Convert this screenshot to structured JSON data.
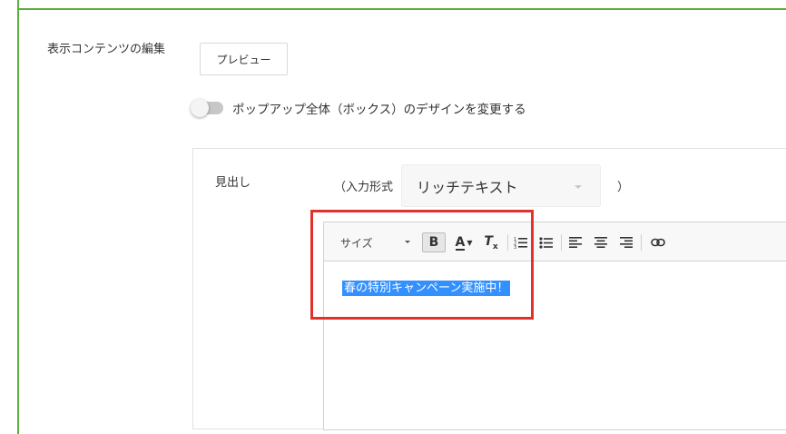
{
  "section": {
    "title": "表示コンテンツの編集",
    "preview_label": "プレビュー"
  },
  "toggle": {
    "label": "ポップアップ全体（ボックス）のデザインを変更する",
    "checked": false
  },
  "field": {
    "heading_label": "見出し",
    "input_format_open": "（入力形式",
    "input_format_value": "リッチテキスト",
    "input_format_close": "）"
  },
  "toolbar": {
    "size_label": "サイズ",
    "bold_label": "B",
    "color_label": "A",
    "clear_label": "T",
    "clear_sub": "x"
  },
  "editor": {
    "content": "春の特別キャンペーン実施中！",
    "selected": true
  },
  "colors": {
    "accent_green": "#5aae3a",
    "highlight_red": "#e0312a",
    "selection_blue": "#3390ff"
  }
}
